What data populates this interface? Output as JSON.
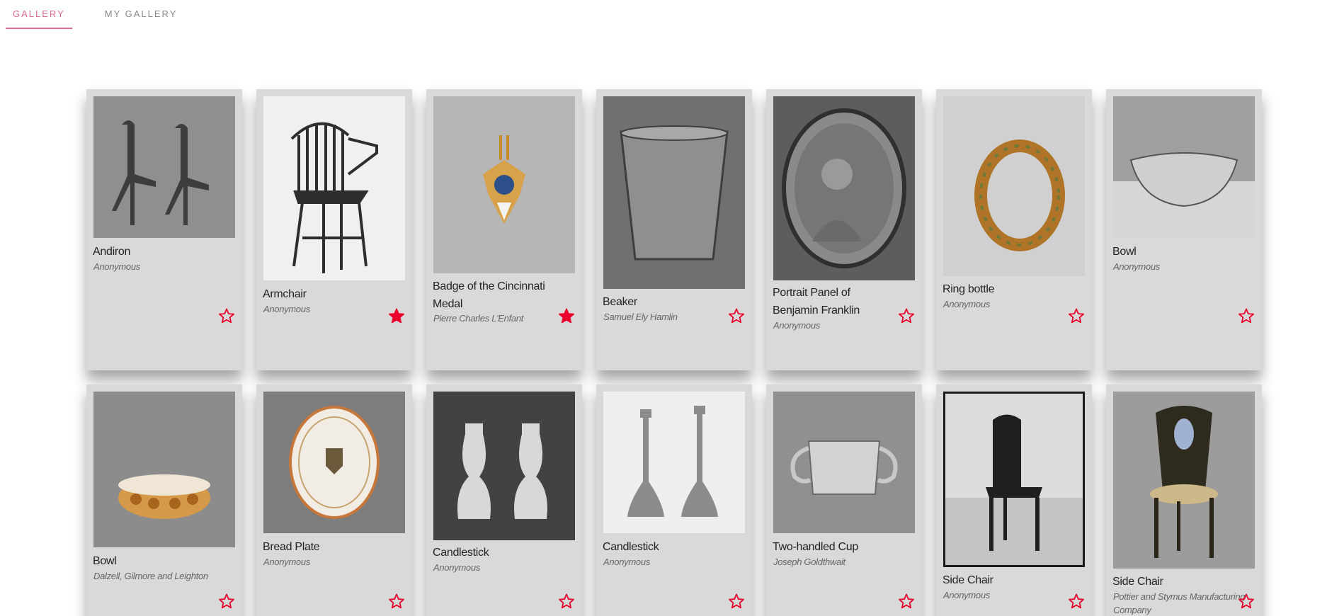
{
  "tabs": [
    {
      "label": "GALLERY",
      "active": true
    },
    {
      "label": "MY GALLERY",
      "active": false
    }
  ],
  "accent_color": "#e8002a",
  "cards": [
    {
      "title": "Andiron",
      "artist": "Anonymous",
      "favorite": false,
      "image": "andirons"
    },
    {
      "title": "Armchair",
      "artist": "Anonymous",
      "favorite": true,
      "image": "windsor-armchair"
    },
    {
      "title": "Badge of the Cincinnati Medal",
      "artist": "Pierre Charles L'Enfant",
      "favorite": true,
      "image": "eagle-badge"
    },
    {
      "title": "Beaker",
      "artist": "Samuel Ely Hamlin",
      "favorite": false,
      "image": "pewter-beaker"
    },
    {
      "title": "Portrait Panel of Benjamin Franklin",
      "artist": "Anonymous",
      "favorite": false,
      "image": "oval-portrait"
    },
    {
      "title": "Ring bottle",
      "artist": "Anonymous",
      "favorite": false,
      "image": "ring-bottle"
    },
    {
      "title": "Bowl",
      "artist": "Anonymous",
      "favorite": false,
      "image": "glass-bowl"
    },
    {
      "title": "Bowl",
      "artist": "Dalzell, Gilmore and Leighton",
      "favorite": false,
      "image": "amber-bowl"
    },
    {
      "title": "Bread Plate",
      "artist": "Anonymous",
      "favorite": false,
      "image": "bread-plate"
    },
    {
      "title": "Candlestick",
      "artist": "Anonymous",
      "favorite": false,
      "image": "glass-candlesticks"
    },
    {
      "title": "Candlestick",
      "artist": "Anonymous",
      "favorite": false,
      "image": "pewter-candlesticks"
    },
    {
      "title": "Two-handled Cup",
      "artist": "Joseph Goldthwait",
      "favorite": false,
      "image": "silver-cup"
    },
    {
      "title": "Side Chair",
      "artist": "Anonymous",
      "favorite": false,
      "image": "side-chair"
    },
    {
      "title": "Side Chair",
      "artist": "Pottier and Stymus Manufacturing Company",
      "favorite": false,
      "image": "ornate-chair"
    }
  ]
}
